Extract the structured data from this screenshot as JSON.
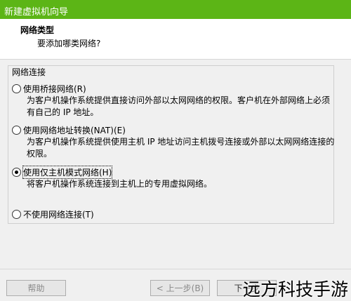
{
  "window": {
    "title": "新建虚拟机向导"
  },
  "header": {
    "title": "网络类型",
    "subtitle": "要添加哪类网络?"
  },
  "group": {
    "label": "网络连接"
  },
  "options": [
    {
      "label": "使用桥接网络(R)",
      "desc": "为客户机操作系统提供直接访问外部以太网网络的权限。客户机在外部网络上必须有自己的 IP 地址。",
      "checked": false
    },
    {
      "label": "使用网络地址转换(NAT)(E)",
      "desc": "为客户机操作系统提供使用主机 IP 地址访问主机拨号连接或外部以太网网络连接的权限。",
      "checked": false
    },
    {
      "label": "使用仅主机模式网络(H)",
      "desc": "将客户机操作系统连接到主机上的专用虚拟网络。",
      "checked": true
    },
    {
      "label": "不使用网络连接(T)",
      "desc": "",
      "checked": false
    }
  ],
  "buttons": {
    "help": "帮助",
    "back": "< 上一步(B)",
    "next": "下一步"
  },
  "watermark": "远方科技手游"
}
